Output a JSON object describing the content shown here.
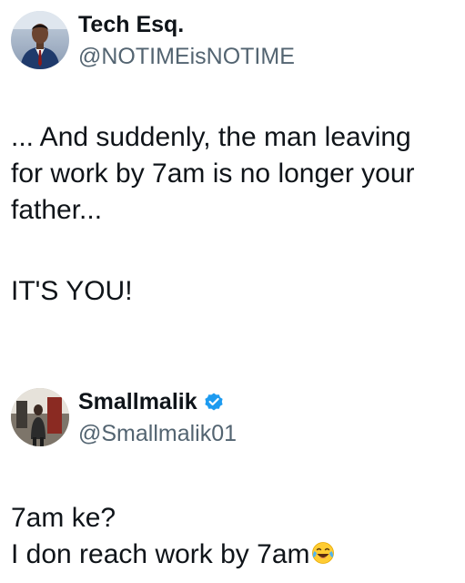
{
  "tweet1": {
    "display_name": "Tech Esq.",
    "handle": "@NOTIMEisNOTIME",
    "text_main": "... And suddenly, the man leaving for work by 7am is no longer your father...",
    "text_emphasis": "IT'S YOU!",
    "avatar_icon": "person-avatar"
  },
  "tweet2": {
    "display_name": "Smallmalik",
    "handle": "@Smallmalik01",
    "verified": true,
    "verified_icon": "verified-badge-icon",
    "text_line1": "7am ke?",
    "text_line2": "I don reach work by 7am",
    "emoji": "tears-of-joy-emoji",
    "avatar_icon": "person-avatar"
  },
  "colors": {
    "text_primary": "#0f1419",
    "text_secondary": "#536471",
    "verified_blue": "#1d9bf0"
  }
}
